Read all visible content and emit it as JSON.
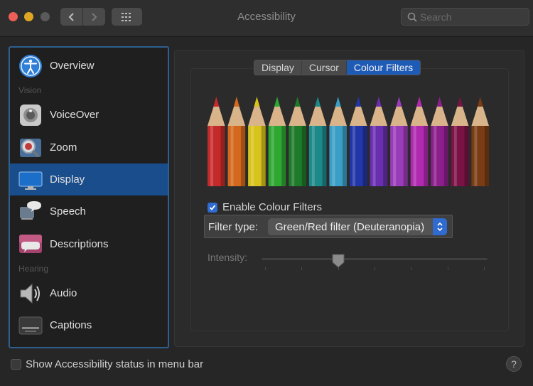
{
  "window": {
    "title": "Accessibility",
    "search_placeholder": "Search"
  },
  "sidebar": {
    "sections": [
      {
        "label": "Vision"
      },
      {
        "label": "Hearing"
      }
    ],
    "items": [
      {
        "label": "Overview",
        "icon": "accessibility-icon"
      },
      {
        "label": "VoiceOver",
        "icon": "voiceover-icon"
      },
      {
        "label": "Zoom",
        "icon": "zoom-icon"
      },
      {
        "label": "Display",
        "icon": "display-icon",
        "selected": true
      },
      {
        "label": "Speech",
        "icon": "speech-icon"
      },
      {
        "label": "Descriptions",
        "icon": "descriptions-icon"
      },
      {
        "label": "Audio",
        "icon": "audio-icon"
      },
      {
        "label": "Captions",
        "icon": "captions-icon"
      }
    ]
  },
  "tabs": [
    {
      "label": "Display"
    },
    {
      "label": "Cursor"
    },
    {
      "label": "Colour Filters",
      "active": true
    }
  ],
  "pencil_colors": [
    "#c42a2a",
    "#d4691e",
    "#d8c31d",
    "#2fa833",
    "#1f7a2a",
    "#1d8a8a",
    "#3a9ec7",
    "#2236a8",
    "#6a2fb0",
    "#9a3bb8",
    "#b02ab0",
    "#8c1f8c",
    "#7a1246",
    "#7a3c14"
  ],
  "colour_filters": {
    "enable_label": "Enable Colour Filters",
    "enabled": true,
    "filter_type_label": "Filter type:",
    "filter_type_value": "Green/Red filter (Deuteranopia)",
    "intensity_label": "Intensity:",
    "intensity_fraction": 0.34
  },
  "footer": {
    "status_checkbox_label": "Show Accessibility status in menu bar",
    "status_checked": false,
    "help_label": "?"
  },
  "colors": {
    "accent": "#2f6bd0",
    "selected_row": "#1a4d8c",
    "sidebar_border": "#2d5f8f"
  }
}
